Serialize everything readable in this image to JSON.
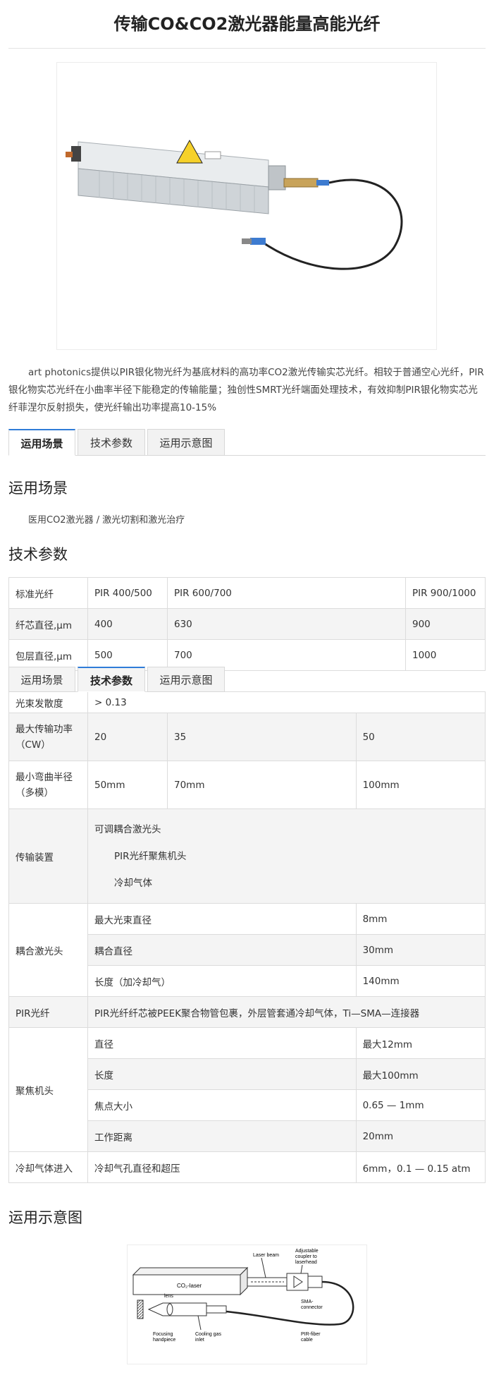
{
  "page": {
    "title": "传输CO&CO2激光器能量高能光纤"
  },
  "intro": "art photonics提供以PIR银化物光纤为基底材料的高功率CO2激光传输实芯光纤。相较于普通空心光纤，PIR银化物实芯光纤在小曲率半径下能稳定的传输能量；独创性SMRT光纤端面处理技术，有效抑制PIR银化物实芯光纤菲涅尔反射损失，使光纤输出功率提高10-15%",
  "tabs": [
    "运用场景",
    "技术参数",
    "运用示意图"
  ],
  "sections": {
    "scene": {
      "heading": "运用场景",
      "text": "医用CO2激光器 / 激光切割和激光治疗"
    },
    "specs": {
      "heading": "技术参数"
    },
    "diagram": {
      "heading": "运用示意图"
    }
  },
  "spec_table": {
    "fiber": {
      "label": "标准光纤",
      "v1": "PIR 400/500",
      "v2": "PIR 600/700",
      "v3": "PIR 900/1000"
    },
    "core": {
      "label": "纤芯直径,μm",
      "v1": "400",
      "v2": "630",
      "v3": "900"
    },
    "clad": {
      "label": "包层直径,μm",
      "v1": "500",
      "v2": "700",
      "v3": "1000"
    },
    "divergence": {
      "label": "光束发散度",
      "value": "> 0.13"
    },
    "power": {
      "label": "最大传输功率（CW）",
      "v1": "20",
      "v2": "35",
      "v3": "50"
    },
    "bend": {
      "label": "最小弯曲半径（多模）",
      "v1": "50mm",
      "v2": "70mm",
      "v3": "100mm"
    },
    "transmission": {
      "label": "传输装置",
      "l1": "可调耦合激光头",
      "l2": "PIR光纤聚焦机头",
      "l3": "冷却气体"
    },
    "coupler": {
      "label": "耦合激光头",
      "r1k": "最大光束直径",
      "r1v": "8mm",
      "r2k": "耦合直径",
      "r2v": "30mm",
      "r3k": "长度（加冷却气）",
      "r3v": "140mm"
    },
    "pir": {
      "label": "PIR光纤",
      "value": "PIR光纤纤芯被PEEK聚合物管包裹，外层管套通冷却气体，Ti—SMA—连接器"
    },
    "focus": {
      "label": "聚焦机头",
      "r1k": "直径",
      "r1v": "最大12mm",
      "r2k": "长度",
      "r2v": "最大100mm",
      "r3k": "焦点大小",
      "r3v": "0.65 — 1mm",
      "r4k": "工作距离",
      "r4v": "20mm"
    },
    "cooling": {
      "label": "冷却气体进入",
      "key": "冷却气孔直径和超压",
      "value": "6mm，0.1 — 0.15 atm"
    }
  },
  "diagram": {
    "laser": "CO₂-laser",
    "beam": "Laser beam",
    "coupler": [
      "Adjustable",
      "coupler to",
      "laserhead"
    ],
    "sma": [
      "SMA-",
      "connector"
    ],
    "lens": "lens",
    "handpiece": [
      "Focusing",
      "handpiece"
    ],
    "gas": [
      "Cooling gas",
      "inlet"
    ],
    "cable": [
      "PIR-fiber",
      "cable"
    ]
  },
  "colors": {
    "accent": "#2f7cd8",
    "border": "#dcdcdc",
    "shade": "#f4f4f4"
  }
}
